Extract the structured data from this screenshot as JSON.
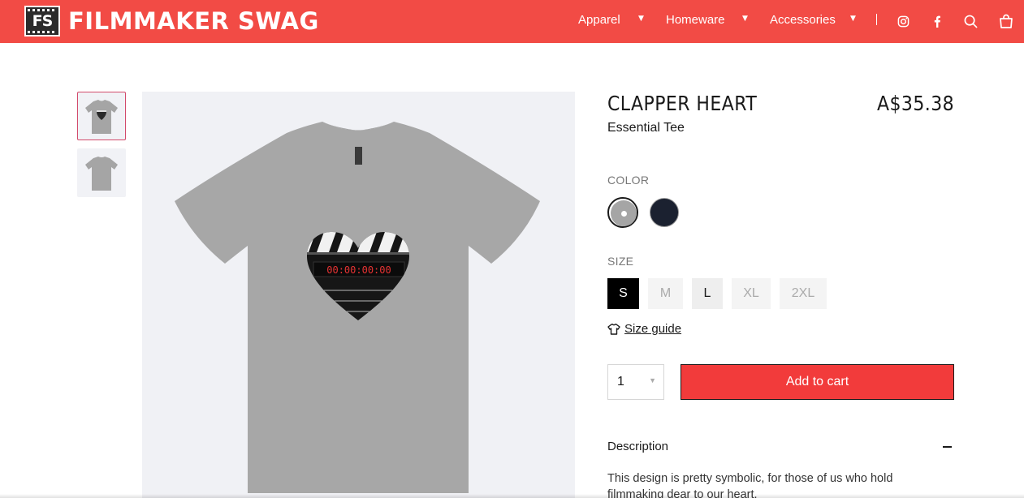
{
  "header": {
    "logo_mark": "FS",
    "logo_text": "FILMMAKER SWAG",
    "nav": [
      {
        "label": "Apparel"
      },
      {
        "label": "Homeware"
      },
      {
        "label": "Accessories"
      }
    ],
    "icons": [
      "instagram-icon",
      "facebook-icon",
      "search-icon",
      "cart-icon"
    ],
    "background_color": "#f24b45"
  },
  "product": {
    "title": "CLAPPER HEART",
    "subtitle": "Essential Tee",
    "price": "A$35.38",
    "color_label": "COLOR",
    "colors": [
      {
        "name": "grey",
        "hex": "#a5a5a5",
        "selected": true
      },
      {
        "name": "navy",
        "hex": "#1b2130",
        "selected": false
      }
    ],
    "size_label": "SIZE",
    "sizes": [
      {
        "label": "S",
        "state": "selected"
      },
      {
        "label": "M",
        "state": "unavailable"
      },
      {
        "label": "L",
        "state": "available"
      },
      {
        "label": "XL",
        "state": "unavailable"
      },
      {
        "label": "2XL",
        "state": "unavailable"
      }
    ],
    "size_guide": "Size guide",
    "quantity": "1",
    "add_to_cart": "Add to cart",
    "add_to_cart_color": "#f23b3b",
    "description_heading": "Description",
    "description_text": "This design is pretty symbolic, for those of us who hold filmmaking dear to our heart."
  },
  "gallery": {
    "thumbnails": [
      "front",
      "back"
    ],
    "clapper_display": "00:00:00:00"
  }
}
